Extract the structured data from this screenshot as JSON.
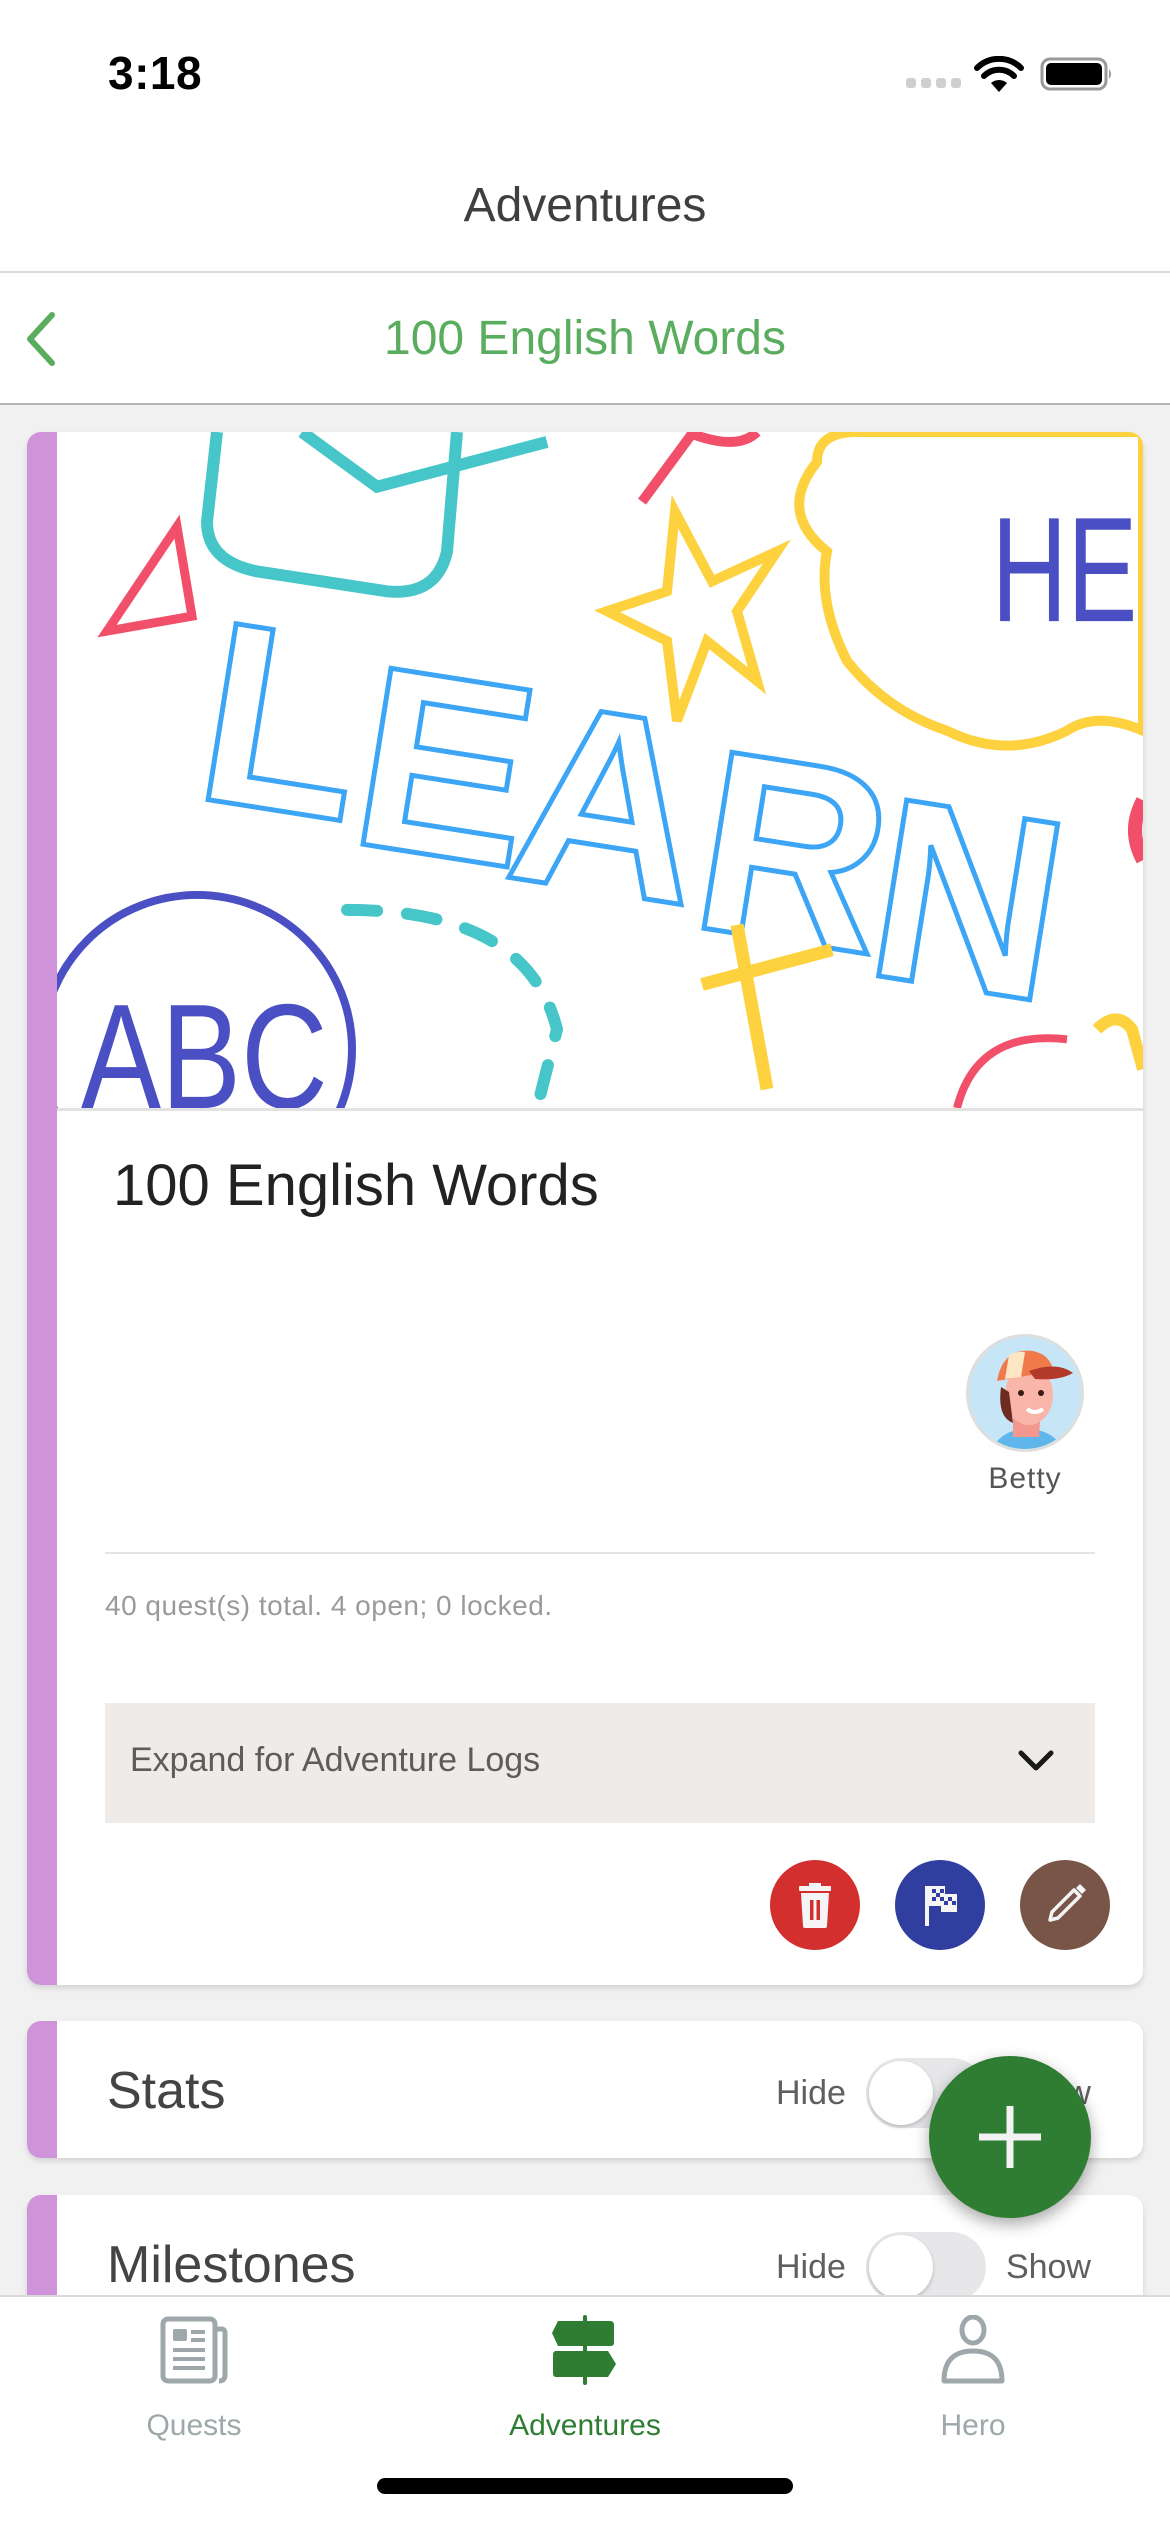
{
  "status_bar": {
    "time": "3:18",
    "icons": [
      "cellular-signal-icon",
      "wifi-icon",
      "battery-icon"
    ]
  },
  "header": {
    "title": "Adventures"
  },
  "subheader": {
    "back_icon": "chevron-left-icon",
    "title": "100 English Words"
  },
  "adventure": {
    "image_alt": "LEARN doodle banner",
    "image_words": [
      "LEARN",
      "HEL",
      "ABC"
    ],
    "title": "100 English Words",
    "owner": {
      "name": "Betty",
      "avatar_icon": "hero-avatar"
    },
    "summary": "40 quest(s) total. 4 open; 0 locked.",
    "quest_counts": {
      "total": 40,
      "open": 4,
      "locked": 0
    },
    "logs_expander": {
      "label": "Expand for Adventure Logs",
      "icon": "chevron-down-icon",
      "expanded": false
    },
    "actions": [
      {
        "name": "delete",
        "icon": "trash-icon",
        "color": "#d32f2f"
      },
      {
        "name": "finish",
        "icon": "checkered-flag-icon",
        "color": "#303f9f"
      },
      {
        "name": "edit",
        "icon": "pencil-icon",
        "color": "#795548"
      }
    ],
    "accent_color": "#ce93d8"
  },
  "sections": [
    {
      "title": "Stats",
      "toggle": {
        "off_label": "Hide",
        "on_label": "Show",
        "on": false
      }
    },
    {
      "title": "Milestones",
      "toggle": {
        "off_label": "Hide",
        "on_label": "Show",
        "on": false
      }
    }
  ],
  "fab": {
    "icon": "plus-icon",
    "color": "#2e7d32"
  },
  "tabbar": {
    "tabs": [
      {
        "label": "Quests",
        "icon": "newspaper-icon",
        "active": false
      },
      {
        "label": "Adventures",
        "icon": "signpost-icon",
        "active": true
      },
      {
        "label": "Hero",
        "icon": "person-icon",
        "active": false
      }
    ],
    "active_color": "#2e7d32",
    "inactive_color": "#9ea7aa"
  },
  "colors": {
    "brand_green": "#5aad5f",
    "background": "#f1f1f1"
  }
}
